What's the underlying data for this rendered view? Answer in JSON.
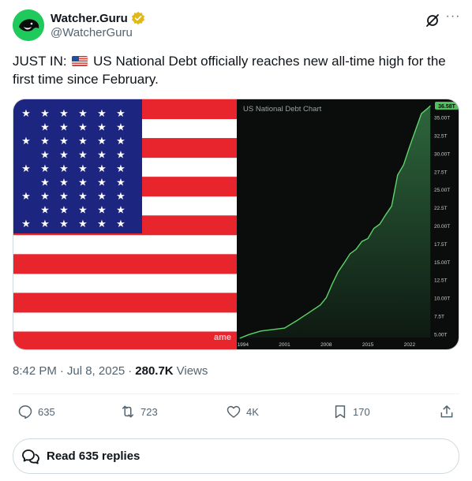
{
  "author": {
    "display_name": "Watcher.Guru",
    "handle": "@WatcherGuru",
    "verified": true
  },
  "tweet": {
    "text_prefix": "JUST IN:",
    "text_body": "US National Debt officially reaches new all-time high for the first time since February."
  },
  "media": {
    "watermark": "ame",
    "chart": {
      "title": "US National Debt Chart",
      "last_value_label": "36.58T",
      "chart_data": {
        "type": "area",
        "title": "US National Debt Chart",
        "xlabel": "",
        "ylabel": "",
        "x_ticks": [
          "1994",
          "2001",
          "2008",
          "2015",
          "2022"
        ],
        "y_ticks": [
          "5.00T",
          "7.5T",
          "10.00T",
          "12.5T",
          "15.00T",
          "17.5T",
          "20.00T",
          "22.5T",
          "25.00T",
          "27.5T",
          "30.00T",
          "32.5T",
          "35.00T"
        ],
        "ylim": [
          4.5,
          36.6
        ],
        "xlim": [
          1993.5,
          2025.6
        ],
        "grid": false,
        "series": [
          {
            "values": [
              [
                1993.5,
                4.4
              ],
              [
                1995,
                4.9
              ],
              [
                1997,
                5.4
              ],
              [
                1999,
                5.6
              ],
              [
                2001,
                5.8
              ],
              [
                2003,
                6.8
              ],
              [
                2005,
                7.9
              ],
              [
                2007,
                9.0
              ],
              [
                2008,
                10.0
              ],
              [
                2009,
                11.9
              ],
              [
                2010,
                13.6
              ],
              [
                2011,
                14.8
              ],
              [
                2012,
                16.1
              ],
              [
                2013,
                16.7
              ],
              [
                2014,
                17.8
              ],
              [
                2015,
                18.2
              ],
              [
                2016,
                19.6
              ],
              [
                2017,
                20.2
              ],
              [
                2018,
                21.5
              ],
              [
                2019,
                22.7
              ],
              [
                2020,
                27.0
              ],
              [
                2021,
                28.4
              ],
              [
                2022,
                30.9
              ],
              [
                2023,
                33.2
              ],
              [
                2024,
                35.5
              ],
              [
                2025,
                36.2
              ],
              [
                2025.5,
                36.58
              ]
            ]
          }
        ]
      }
    }
  },
  "meta": {
    "time": "8:42 PM",
    "sep1": "·",
    "date": "Jul 8, 2025",
    "sep2": "·",
    "views_count": "280.7K",
    "views_label": "Views"
  },
  "actions": {
    "replies": "635",
    "retweets": "723",
    "likes": "4K",
    "bookmarks": "170"
  },
  "read_replies_label": "Read 635 replies",
  "colors": {
    "accent": "#1d9bf0",
    "avatar_bg": "#1fc95c",
    "verified_badge": "#e2b719",
    "chart_line": "#5fd36a",
    "flag_red": "#e8242c",
    "flag_blue": "#1c2680"
  },
  "icons": {
    "verified": "verified-badge-icon",
    "grok": "grok-icon",
    "more": "more-icon",
    "reply": "reply-icon",
    "retweet": "retweet-icon",
    "like": "heart-icon",
    "bookmark": "bookmark-icon",
    "share": "share-icon",
    "read_replies": "speech-bubbles-icon"
  }
}
